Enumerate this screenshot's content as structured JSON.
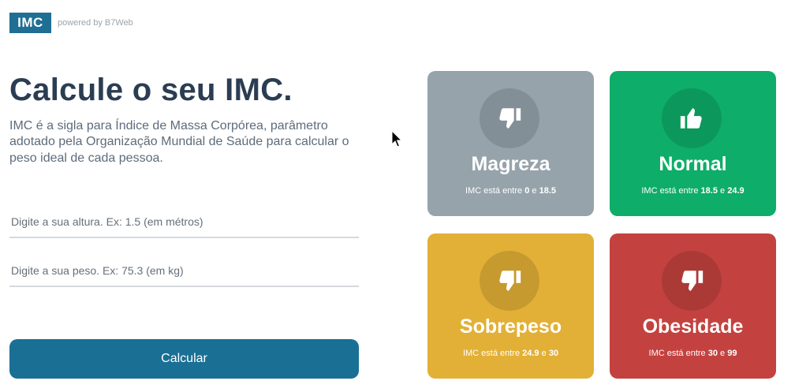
{
  "header": {
    "logo": "IMC",
    "powered_by": "powered by B7Web"
  },
  "main": {
    "title": "Calcule o seu IMC.",
    "description": "IMC é a sigla para Índice de Massa Corpórea, parâmetro adotado pela Organização Mundial de Saúde para calcular o peso ideal de cada pessoa.",
    "height_input": {
      "value": "",
      "placeholder": "Digite a sua altura. Ex: 1.5 (em métros)"
    },
    "weight_input": {
      "value": "",
      "placeholder": "Digite a sua peso. Ex: 75.3 (em kg)"
    },
    "calculate_label": "Calcular"
  },
  "levels": [
    {
      "name": "Magreza",
      "prefix": "IMC está entre",
      "min": "0",
      "joiner": "e",
      "max": "18.5",
      "color": "#96a3ab",
      "icon": "thumbs-down-icon"
    },
    {
      "name": "Normal",
      "prefix": "IMC está entre",
      "min": "18.5",
      "joiner": "e",
      "max": "24.9",
      "color": "#0ead69",
      "icon": "thumbs-up-icon"
    },
    {
      "name": "Sobrepeso",
      "prefix": "IMC está entre",
      "min": "24.9",
      "joiner": "e",
      "max": "30",
      "color": "#e2b036",
      "icon": "thumbs-down-icon"
    },
    {
      "name": "Obesidade",
      "prefix": "IMC está entre",
      "min": "30",
      "joiner": "e",
      "max": "99",
      "color": "#c3423f",
      "icon": "thumbs-down-icon"
    }
  ]
}
